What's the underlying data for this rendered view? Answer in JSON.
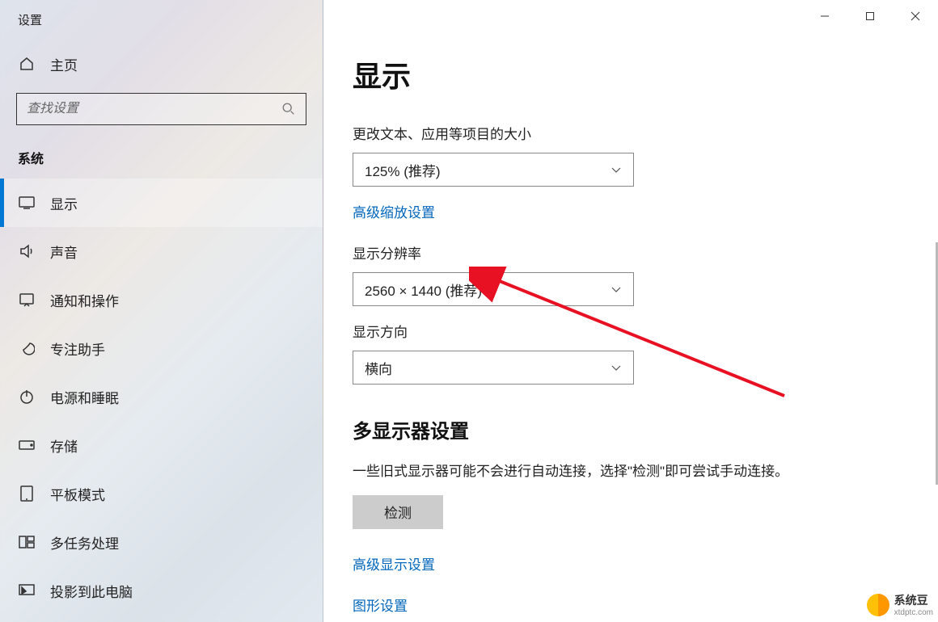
{
  "window": {
    "title": "设置"
  },
  "sidebar": {
    "home": "主页",
    "search_placeholder": "查找设置",
    "section": "系统",
    "items": [
      {
        "id": "display",
        "label": "显示",
        "active": true
      },
      {
        "id": "sound",
        "label": "声音"
      },
      {
        "id": "notifications",
        "label": "通知和操作"
      },
      {
        "id": "focus",
        "label": "专注助手"
      },
      {
        "id": "power",
        "label": "电源和睡眠"
      },
      {
        "id": "storage",
        "label": "存储"
      },
      {
        "id": "tablet",
        "label": "平板模式"
      },
      {
        "id": "multitask",
        "label": "多任务处理"
      },
      {
        "id": "project",
        "label": "投影到此电脑"
      }
    ]
  },
  "main": {
    "title": "显示",
    "scale_label": "更改文本、应用等项目的大小",
    "scale_value": "125% (推荐)",
    "advanced_scale_link": "高级缩放设置",
    "resolution_label": "显示分辨率",
    "resolution_value": "2560 × 1440 (推荐)",
    "orientation_label": "显示方向",
    "orientation_value": "横向",
    "multi_title": "多显示器设置",
    "multi_help": "一些旧式显示器可能不会进行自动连接，选择\"检测\"即可尝试手动连接。",
    "detect_button": "检测",
    "advanced_display_link": "高级显示设置",
    "graphics_link": "图形设置"
  },
  "watermark": {
    "name": "系统豆",
    "url": "xtdptc.com"
  }
}
